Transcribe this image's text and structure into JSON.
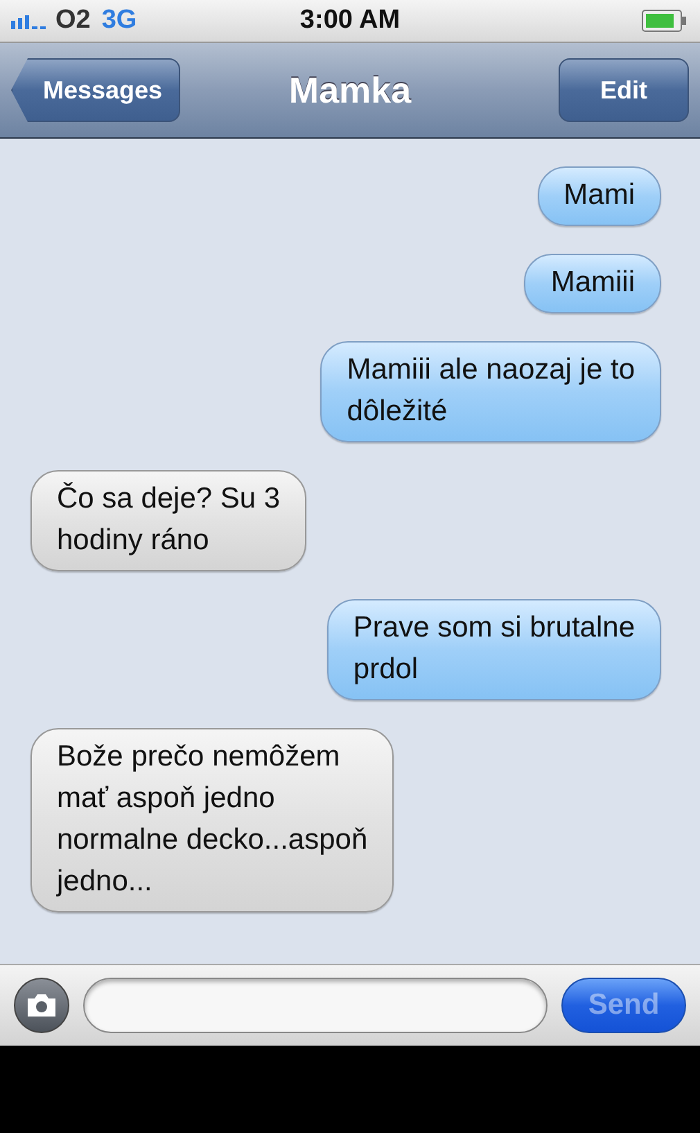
{
  "status_bar": {
    "carrier": "O2",
    "network": "3G",
    "time": "3:00 AM"
  },
  "nav_bar": {
    "back": "Messages",
    "title": "Mamka",
    "edit": "Edit"
  },
  "messages": [
    {
      "text": "Mami",
      "kind": "sent"
    },
    {
      "text": "Mamiii",
      "kind": "sent"
    },
    {
      "text": "Mamiii ale naozaj je to\ndôležité",
      "kind": "sent"
    },
    {
      "text": "Čo sa deje? Su 3\nhodiny ráno",
      "kind": "received"
    },
    {
      "text": "Prave som si brutalne\nprdol",
      "kind": "sent"
    },
    {
      "text": "Bože prečo nemôžem\nmať aspoň jedno\nnormalne decko...aspoň\njedno...",
      "kind": "received"
    }
  ],
  "compose": {
    "send": "Send",
    "send_disabled": true
  }
}
